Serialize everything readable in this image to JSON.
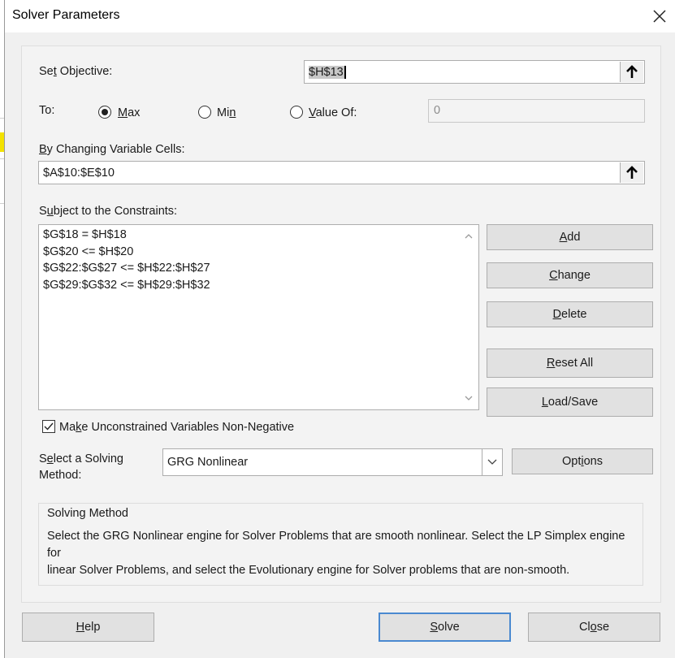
{
  "window": {
    "title": "Solver Parameters"
  },
  "objective": {
    "label_pre": "Se",
    "label_key": "t",
    "label_post": " Objective:",
    "value": "$H$13"
  },
  "to": {
    "label": "To:",
    "options": [
      {
        "pre": "",
        "key": "M",
        "post": "ax",
        "selected": true
      },
      {
        "pre": "Mi",
        "key": "n",
        "post": "",
        "selected": false
      },
      {
        "pre": "",
        "key": "V",
        "post": "alue Of:",
        "selected": false
      }
    ],
    "value_of": "0"
  },
  "changing_cells": {
    "label_pre": "",
    "label_key": "B",
    "label_post": "y Changing Variable Cells:",
    "value": "$A$10:$E$10"
  },
  "constraints": {
    "label_pre": "S",
    "label_key": "u",
    "label_post": "bject to the Constraints:",
    "items": [
      "$G$18 = $H$18",
      "$G$20 <= $H$20",
      "$G$22:$G$27 <= $H$22:$H$27",
      "$G$29:$G$32 <= $H$29:$H$32"
    ]
  },
  "side_buttons": {
    "add": {
      "pre": "",
      "key": "A",
      "post": "dd"
    },
    "change": {
      "pre": "",
      "key": "C",
      "post": "hange"
    },
    "delete": {
      "pre": "",
      "key": "D",
      "post": "elete"
    },
    "reset": {
      "pre": "",
      "key": "R",
      "post": "eset All"
    },
    "loadsave": {
      "pre": "",
      "key": "L",
      "post": "oad/Save"
    }
  },
  "nonneg": {
    "pre": "Ma",
    "key": "k",
    "post": "e Unconstrained Variables Non-Negative",
    "checked": true
  },
  "method": {
    "label1_pre": "S",
    "label1_key": "e",
    "label1_post": "lect a Solving",
    "label2": "Method:",
    "value": "GRG Nonlinear",
    "options_btn": {
      "pre": "Opt",
      "key": "i",
      "post": "ons"
    }
  },
  "solving_method": {
    "title": "Solving Method",
    "text": "Select the GRG Nonlinear engine for Solver Problems that are smooth nonlinear. Select the LP Simplex engine for\nlinear Solver Problems, and select the Evolutionary engine for Solver problems that are non-smooth."
  },
  "footer": {
    "help": {
      "pre": "",
      "key": "H",
      "post": "elp"
    },
    "solve": {
      "pre": "",
      "key": "S",
      "post": "olve"
    },
    "close": {
      "pre": "Cl",
      "key": "o",
      "post": "se"
    }
  }
}
